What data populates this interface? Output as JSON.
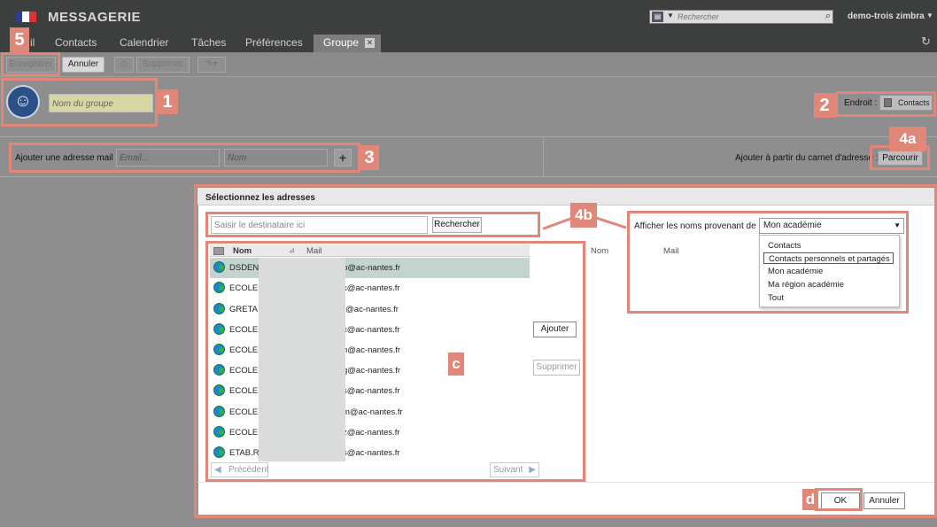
{
  "header": {
    "app_title": "MESSAGERIE",
    "search_placeholder": "Rechercher",
    "username": "demo-trois zimbra"
  },
  "tabs": [
    {
      "label": "il"
    },
    {
      "label": "Contacts"
    },
    {
      "label": "Calendrier"
    },
    {
      "label": "Tâches"
    },
    {
      "label": "Préférences"
    },
    {
      "label": "Groupe",
      "active": true
    }
  ],
  "toolbar": {
    "save": "Enregistrer",
    "cancel": "Annuler",
    "delete": "Supprimer"
  },
  "group": {
    "name_placeholder": "Nom du groupe",
    "location_label": "Endroit :",
    "location_value": "Contacts"
  },
  "add_address": {
    "label": "Ajouter une adresse mail :",
    "email_placeholder": "Email...",
    "name_placeholder": "Nom",
    "from_addressbook_label": "Ajouter à partir du carnet d'adresse :",
    "browse": "Parcourir"
  },
  "dialog": {
    "title": "Sélectionnez les adresses",
    "recipient_placeholder": "Saisir le destinataire ici",
    "search_button": "Rechercher",
    "source_label": "Afficher les noms provenant de :",
    "source_selected": "Mon académie",
    "source_options": [
      "Contacts",
      "Contacts personnels et partagés",
      "Mon académie",
      "Ma région académie",
      "Tout"
    ],
    "left_columns": {
      "name": "Nom",
      "mail": "Mail"
    },
    "right_columns": {
      "name": "Nom",
      "mail": "Mail"
    },
    "rows": [
      {
        "name": "DSDEN",
        "mail": "p@ac-nantes.fr"
      },
      {
        "name": "ECOLE E",
        "mail": "k@ac-nantes.fr"
      },
      {
        "name": "GRETA D",
        "mail": "r@ac-nantes.fr"
      },
      {
        "name": "ECOLE M",
        "mail": "x@ac-nantes.fr"
      },
      {
        "name": "ECOLE M",
        "mail": "n@ac-nantes.fr"
      },
      {
        "name": "ECOLE M",
        "mail": "g@ac-nantes.fr"
      },
      {
        "name": "ECOLE E",
        "mail": "s@ac-nantes.fr"
      },
      {
        "name": "ECOLE M",
        "mail": "m@ac-nantes.fr"
      },
      {
        "name": "ECOLE M",
        "mail": "z@ac-nantes.fr"
      },
      {
        "name": "ETAB.RE",
        "mail": "s@ac-nantes.fr"
      }
    ],
    "add_button": "Ajouter",
    "remove_button": "Supprimer",
    "prev": "Précédent",
    "next": "Suivant",
    "ok": "OK",
    "cancel": "Annuler"
  },
  "callouts": [
    "1",
    "2",
    "3",
    "4a",
    "4b",
    "5",
    "c",
    "d"
  ],
  "colors": {
    "callout": "#e0877a",
    "header_bg": "#3d3f3e",
    "selected_row": "#c3d3d0"
  }
}
